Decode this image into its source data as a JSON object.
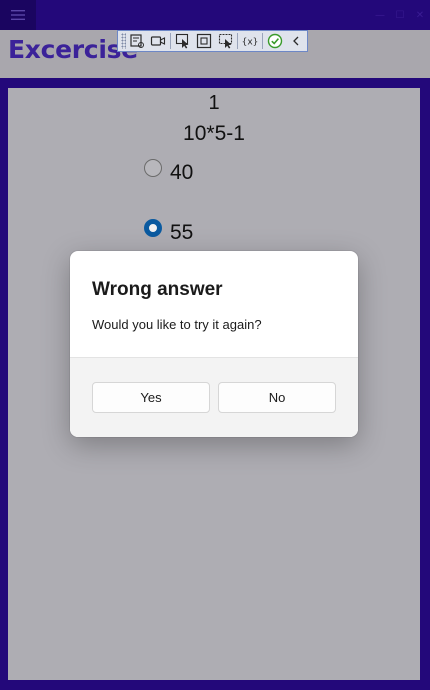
{
  "header": {
    "title": "Excercise"
  },
  "toolbar": {
    "icons": [
      "select-element-icon",
      "record-icon",
      "pointer-icon",
      "frame-icon",
      "display-layout-icon",
      "binding-icon",
      "check-icon",
      "collapse-icon"
    ]
  },
  "question": {
    "number": "1",
    "text": "10*5-1",
    "options": [
      {
        "label": "40",
        "selected": false
      },
      {
        "label": "55",
        "selected": true
      }
    ]
  },
  "dialog": {
    "title": "Wrong answer",
    "message": "Would you like to try it again?",
    "primary_label": "Yes",
    "secondary_label": "No"
  },
  "colors": {
    "frame": "#23087a",
    "title_text": "#3b2299",
    "content_bg": "#aeadb3",
    "radio_accent": "#0a5aa0"
  }
}
